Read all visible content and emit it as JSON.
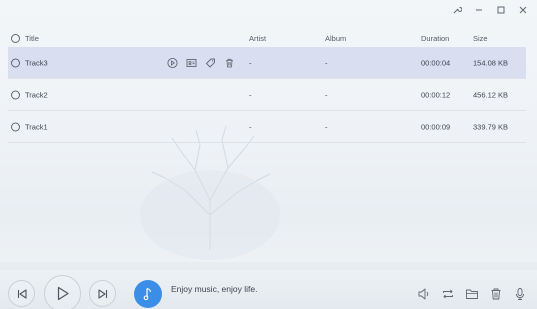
{
  "window": {
    "controls": [
      "wrench-icon",
      "minimize-icon",
      "maximize-icon",
      "close-icon"
    ]
  },
  "table": {
    "headers": {
      "title": "Title",
      "artist": "Artist",
      "album": "Album",
      "duration": "Duration",
      "size": "Size"
    },
    "rows": [
      {
        "title": "Track3",
        "artist": "-",
        "album": "-",
        "duration": "00:00:04",
        "size": "154.08 KB",
        "selected": true
      },
      {
        "title": "Track2",
        "artist": "-",
        "album": "-",
        "duration": "00:00:12",
        "size": "456.12 KB",
        "selected": false
      },
      {
        "title": "Track1",
        "artist": "-",
        "album": "-",
        "duration": "00:00:09",
        "size": "339.79 KB",
        "selected": false
      }
    ],
    "row_actions": [
      "play-circle-icon",
      "contact-card-icon",
      "tag-icon",
      "trash-icon"
    ]
  },
  "player": {
    "tagline": "Enjoy music, enjoy life.",
    "accent": "#3b8ee8",
    "tools": [
      "volume-icon",
      "repeat-icon",
      "folder-icon",
      "trash-icon",
      "microphone-icon"
    ]
  },
  "colors": {
    "selected_row": "#d9def0",
    "icon": "#5f6670"
  }
}
